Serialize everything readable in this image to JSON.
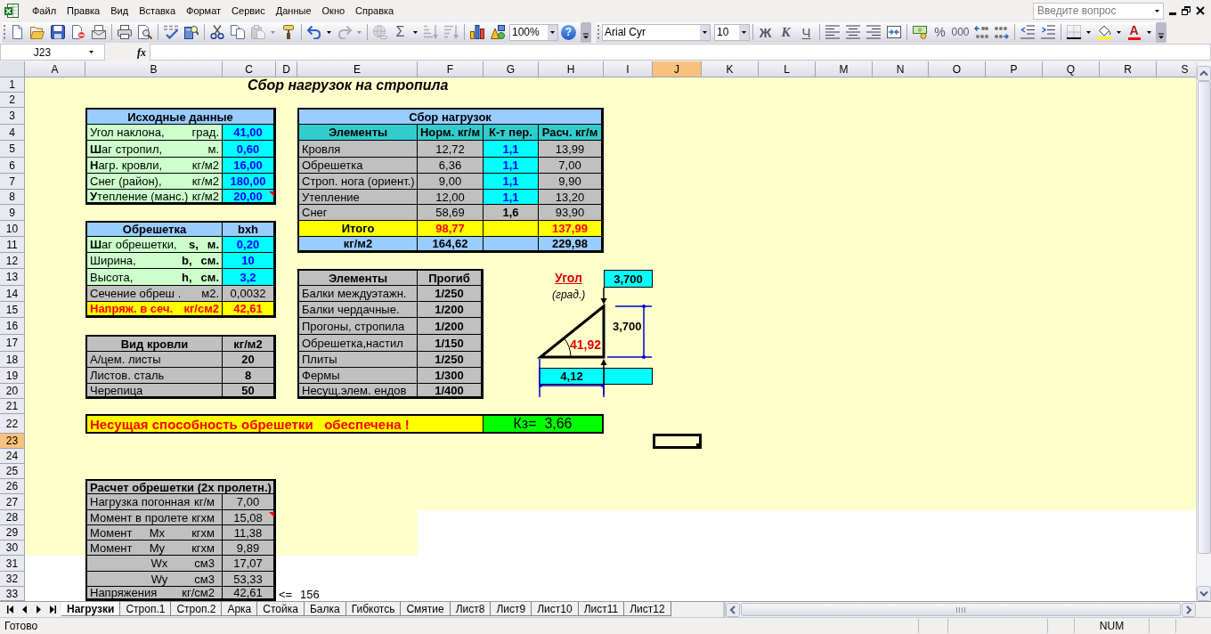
{
  "menu_bar": {
    "items": [
      "Файл",
      "Правка",
      "Вид",
      "Вставка",
      "Формат",
      "Сервис",
      "Данные",
      "Окно",
      "Справка"
    ],
    "help_search": {
      "placeholder": "Введите вопрос"
    }
  },
  "standard_toolbar": [
    [
      {
        "kind": "new",
        "dropdown": false,
        "disabled": false
      },
      {
        "kind": "open",
        "dropdown": false,
        "disabled": false
      },
      {
        "kind": "save",
        "dropdown": false,
        "disabled": false
      },
      {
        "kind": "permission",
        "dropdown": false,
        "disabled": false
      },
      {
        "kind": "email",
        "dropdown": false,
        "disabled": false
      }
    ],
    [
      {
        "kind": "print",
        "dropdown": false,
        "disabled": false
      },
      {
        "kind": "print_preview",
        "dropdown": false,
        "disabled": false
      }
    ],
    [
      {
        "kind": "spelling",
        "dropdown": false,
        "disabled": false
      },
      {
        "kind": "research",
        "dropdown": false,
        "disabled": false
      }
    ],
    [
      {
        "kind": "cut",
        "dropdown": false,
        "disabled": false
      },
      {
        "kind": "copy",
        "dropdown": false,
        "disabled": false
      },
      {
        "kind": "paste",
        "dropdown": true,
        "disabled": true
      },
      {
        "kind": "format_painter",
        "dropdown": false,
        "disabled": false
      }
    ],
    [
      {
        "kind": "undo",
        "dropdown": true,
        "disabled": false
      },
      {
        "kind": "redo",
        "dropdown": true,
        "disabled": true
      }
    ],
    [
      {
        "kind": "hyperlink",
        "dropdown": false,
        "disabled": true
      },
      {
        "kind": "autosum",
        "label": "Σ",
        "dropdown": true,
        "disabled": false
      },
      {
        "kind": "sort_ascending",
        "dropdown": false,
        "disabled": true
      },
      {
        "kind": "sort_descending",
        "dropdown": false,
        "disabled": true
      }
    ],
    [
      {
        "kind": "chart_wizard",
        "dropdown": false,
        "disabled": false
      },
      {
        "kind": "drawing",
        "dropdown": false,
        "disabled": false
      },
      {
        "kind": "zoom",
        "value": "100%",
        "dropdown": false,
        "disabled": false
      },
      {
        "kind": "help",
        "label": "?",
        "dropdown": false,
        "disabled": false
      }
    ]
  ],
  "formatting_toolbar": [
    [
      {
        "kind": "font",
        "value": "Arial Cyr",
        "dropdown": false,
        "disabled": false
      },
      {
        "kind": "font_size",
        "value": "10",
        "dropdown": false,
        "disabled": false
      }
    ],
    [
      {
        "kind": "bold",
        "label": "Ж",
        "dropdown": false,
        "disabled": false
      },
      {
        "kind": "italic",
        "label": "К",
        "dropdown": false,
        "disabled": false
      },
      {
        "kind": "underline",
        "label": "Ч",
        "dropdown": false,
        "disabled": false
      }
    ],
    [
      {
        "kind": "align_left",
        "dropdown": false,
        "disabled": false
      },
      {
        "kind": "align_center",
        "dropdown": false,
        "disabled": false
      },
      {
        "kind": "align_right",
        "dropdown": false,
        "disabled": false
      },
      {
        "kind": "merge",
        "dropdown": false,
        "disabled": false
      }
    ],
    [
      {
        "kind": "currency",
        "dropdown": false,
        "disabled": false
      },
      {
        "kind": "percent",
        "label": "%",
        "dropdown": false,
        "disabled": false
      },
      {
        "kind": "thousands",
        "label": "000",
        "dropdown": false,
        "disabled": false
      },
      {
        "kind": "increase_decimal",
        "dropdown": false,
        "disabled": false
      },
      {
        "kind": "decrease_decimal",
        "dropdown": false,
        "disabled": false
      }
    ],
    [
      {
        "kind": "decrease_indent",
        "dropdown": false,
        "disabled": false
      },
      {
        "kind": "increase_indent",
        "dropdown": false,
        "disabled": false
      }
    ],
    [
      {
        "kind": "borders",
        "dropdown": true,
        "disabled": false
      },
      {
        "kind": "fill_color",
        "dropdown": true,
        "disabled": false
      },
      {
        "kind": "font_color",
        "label": "A",
        "dropdown": true,
        "disabled": false
      }
    ]
  ],
  "formula_bar": {
    "name_box": "J23",
    "function_label": "fx"
  },
  "column_headers": [
    {
      "label": "A",
      "selected": false
    },
    {
      "label": "B",
      "selected": false
    },
    {
      "label": "C",
      "selected": false
    },
    {
      "label": "D",
      "selected": false
    },
    {
      "label": "E",
      "selected": false
    },
    {
      "label": "F",
      "selected": false
    },
    {
      "label": "G",
      "selected": false
    },
    {
      "label": "H",
      "selected": false
    },
    {
      "label": "I",
      "selected": false
    },
    {
      "label": "J",
      "selected": true
    },
    {
      "label": "K",
      "selected": false
    },
    {
      "label": "L",
      "selected": false
    },
    {
      "label": "M",
      "selected": false
    },
    {
      "label": "N",
      "selected": false
    },
    {
      "label": "O",
      "selected": false
    },
    {
      "label": "P",
      "selected": false
    },
    {
      "label": "Q",
      "selected": false
    },
    {
      "label": "R",
      "selected": false
    },
    {
      "label": "S",
      "selected": false
    }
  ],
  "row_headers": [
    {
      "label": "1",
      "selected": false
    },
    {
      "label": "2",
      "selected": false
    },
    {
      "label": "3",
      "selected": false
    },
    {
      "label": "4",
      "selected": false
    },
    {
      "label": "5",
      "selected": false
    },
    {
      "label": "6",
      "selected": false
    },
    {
      "label": "7",
      "selected": false
    },
    {
      "label": "8",
      "selected": false
    },
    {
      "label": "9",
      "selected": false
    },
    {
      "label": "10",
      "selected": false
    },
    {
      "label": "11",
      "selected": false
    },
    {
      "label": "12",
      "selected": false
    },
    {
      "label": "13",
      "selected": false
    },
    {
      "label": "14",
      "selected": false
    },
    {
      "label": "15",
      "selected": false
    },
    {
      "label": "16",
      "selected": false
    },
    {
      "label": "17",
      "selected": false
    },
    {
      "label": "18",
      "selected": false
    },
    {
      "label": "19",
      "selected": false
    },
    {
      "label": "20",
      "selected": false
    },
    {
      "label": "21",
      "selected": false
    },
    {
      "label": "22",
      "selected": false
    },
    {
      "label": "23",
      "selected": true
    },
    {
      "label": "24",
      "selected": false
    },
    {
      "label": "25",
      "selected": false
    },
    {
      "label": "26",
      "selected": false
    },
    {
      "label": "27",
      "selected": false
    },
    {
      "label": "28",
      "selected": false
    },
    {
      "label": "29",
      "selected": false
    },
    {
      "label": "30",
      "selected": false
    },
    {
      "label": "31",
      "selected": false
    },
    {
      "label": "32",
      "selected": false
    },
    {
      "label": "33",
      "selected": false
    }
  ],
  "sheet": {
    "title": "Сбор нагрузок на стропила",
    "input_table": {
      "header": "Исходные данные",
      "rows": [
        {
          "label": "Угол наклона,",
          "unit": "град.",
          "value": "41,00",
          "comment": false
        },
        {
          "label": "**Ш**аг стропил,",
          "unit": "м.",
          "value": "0,60",
          "comment": false
        },
        {
          "label": "**Н**агр. кровли,",
          "unit": "кг/м2",
          "value": "16,00",
          "comment": false
        },
        {
          "label": "Снег (район),",
          "unit": "кг/м2",
          "value": "180,00",
          "comment": false
        },
        {
          "label": "**У**тепление (манс.)",
          "unit": "кг/м2",
          "value": "20,00",
          "comment": true
        }
      ]
    },
    "lathing_table": {
      "headers": [
        "Обрешетка",
        "bxh"
      ],
      "rows": [
        {
          "kind": "input",
          "label": "**Ш**аг обрешетки,",
          "symbol": "s,",
          "unit": "м.",
          "value": "0,20"
        },
        {
          "kind": "input",
          "label": "Ширина,",
          "symbol": "b,",
          "unit": "см.",
          "value": "10"
        },
        {
          "kind": "input",
          "label": "Высота,",
          "symbol": "h,",
          "unit": "см.",
          "value": "3,2"
        },
        {
          "kind": "computed",
          "label": "Сечение обреш .",
          "unit": "м2.",
          "value": "0,0032"
        },
        {
          "kind": "result",
          "label": "Напряж. в сеч.",
          "unit": "кг/см2",
          "value": "42,61"
        }
      ]
    },
    "roofing_table": {
      "headers": [
        "Вид кровли",
        "кг/м2"
      ],
      "rows": [
        {
          "label": "А/цем. листы",
          "value": "20"
        },
        {
          "label": "Листов. сталь",
          "value": "8"
        },
        {
          "label": "Черепица",
          "value": "50"
        }
      ]
    },
    "loads_table": {
      "title": "Сбор нагрузок",
      "columns": [
        "Элементы",
        "Норм. кг/м",
        "К-т пер.",
        "Расч. кг/м"
      ],
      "rows": [
        {
          "kind": "item",
          "label": "Кровля",
          "normative": "12,72",
          "factor": "1,1",
          "factor_editable": true,
          "design": "13,99"
        },
        {
          "kind": "item",
          "label": "Обрешетка",
          "normative": "6,36",
          "factor": "1,1",
          "factor_editable": true,
          "design": "7,00"
        },
        {
          "kind": "item",
          "label": "Строп. нога (ориент.)",
          "normative": "9,00",
          "factor": "1,1",
          "factor_editable": true,
          "design": "9,90"
        },
        {
          "kind": "item",
          "label": "Утепление",
          "normative": "12,00",
          "factor": "1,1",
          "factor_editable": true,
          "design": "13,20"
        },
        {
          "kind": "item",
          "label": "Снег",
          "normative": "58,69",
          "factor": "1,6",
          "factor_editable": false,
          "design": "93,90"
        },
        {
          "kind": "total",
          "label": "Итого",
          "normative": "98,77",
          "design": "137,99"
        },
        {
          "kind": "per_area",
          "label": "кг/м2",
          "normative": "164,62",
          "design": "229,98"
        }
      ]
    },
    "deflection_table": {
      "columns": [
        "Элементы",
        "Прогиб"
      ],
      "rows": [
        {
          "label": "Балки междуэтажн.",
          "value": "1/250"
        },
        {
          "label": "Балки чердачные.",
          "value": "1/200"
        },
        {
          "label": "Прогоны, стропила",
          "value": "1/200"
        },
        {
          "label": "Обрешетка,настил",
          "value": "1/150"
        },
        {
          "label": "Плиты",
          "value": "1/250"
        },
        {
          "label": "Фермы",
          "value": "1/300"
        },
        {
          "label": "Несущ.элем. ендов",
          "value": "1/400"
        }
      ]
    },
    "angle_diagram": {
      "label": "Угол",
      "note": "(град.)",
      "rise_input": "3,700",
      "rise": "3,700",
      "angle": "41,92",
      "run": "4,12"
    },
    "verdict": {
      "message": "Несущая способность обрешетки   обеспечена !",
      "safety_factor": "Кз=  3,66"
    },
    "calc_table": {
      "header": "Расчет обрешетки (2х пролетн.)",
      "rows": [
        {
          "label": "Нагрузка погонная",
          "unit": "кг/м",
          "value": "7,00",
          "comment": false
        },
        {
          "label": "Момент в пролете",
          "unit": "кгхм",
          "value": "15,08",
          "comment": true
        },
        {
          "label": "Момент",
          "symbol": "Mx",
          "unit": "кгхм",
          "value": "11,38",
          "comment": false
        },
        {
          "label": "Момент",
          "symbol": "My",
          "unit": "кгхм",
          "value": "9,89",
          "comment": false
        },
        {
          "symbol": "Wx",
          "unit": "см3",
          "value": "17,07",
          "comment": false
        },
        {
          "symbol": "Wy",
          "unit": "см3",
          "value": "53,33",
          "comment": false
        },
        {
          "label": "Напряжения",
          "unit": "кг/см2",
          "value": "42,61",
          "comment": false
        }
      ],
      "limit": {
        "sign": "<=",
        "value": "156"
      }
    }
  },
  "sheet_tabs": [
    {
      "label": "Нагрузки",
      "selected": true
    },
    {
      "label": "Строп.1",
      "selected": false
    },
    {
      "label": "Строп.2",
      "selected": false
    },
    {
      "label": "Арка",
      "selected": false
    },
    {
      "label": "Стойка",
      "selected": false
    },
    {
      "label": "Балка",
      "selected": false
    },
    {
      "label": "Гибкотсь",
      "selected": false
    },
    {
      "label": "Смятие",
      "selected": false
    },
    {
      "label": "Лист8",
      "selected": false
    },
    {
      "label": "Лист9",
      "selected": false
    },
    {
      "label": "Лист10",
      "selected": false
    },
    {
      "label": "Лист11",
      "selected": false
    },
    {
      "label": "Лист12",
      "selected": false
    }
  ],
  "status_bar": {
    "text": "Готово",
    "indicators": [
      "NUM"
    ]
  }
}
